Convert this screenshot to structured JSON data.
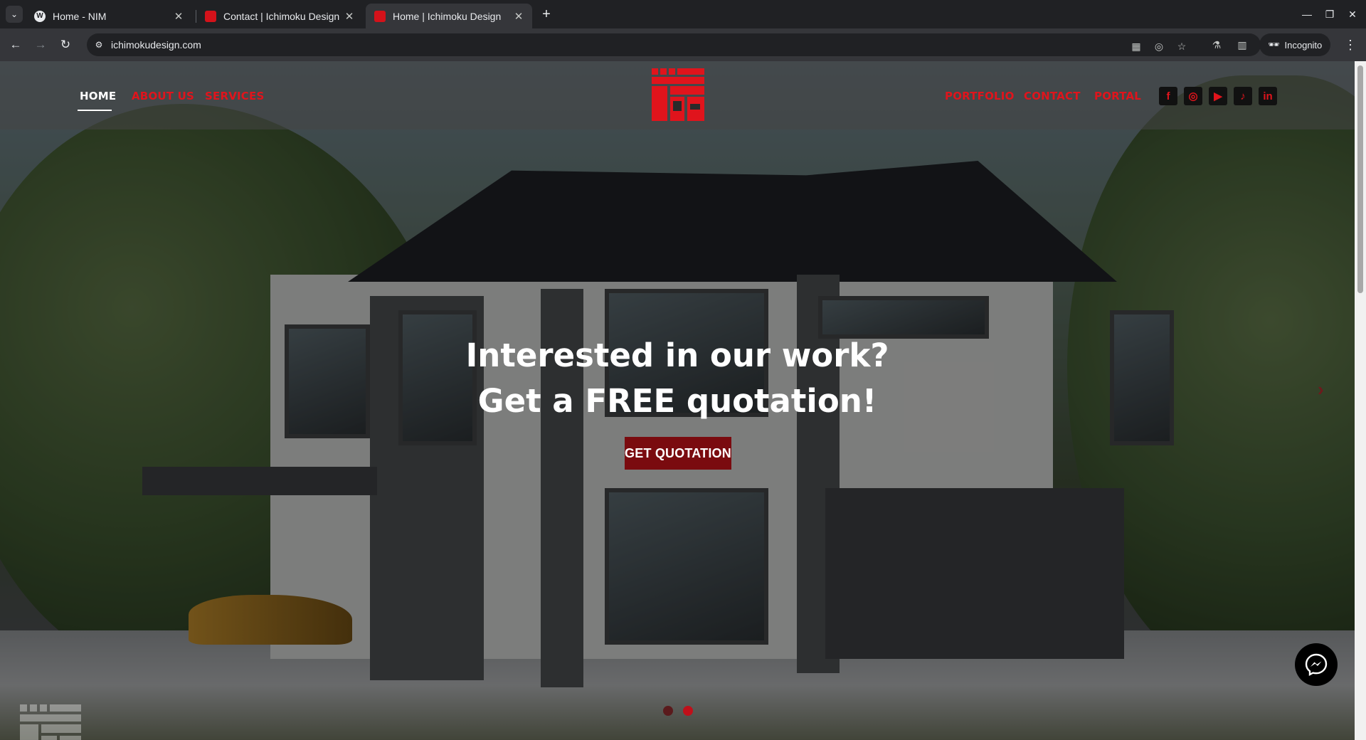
{
  "browser": {
    "tabs": [
      {
        "title": "Home - NIM",
        "active": false
      },
      {
        "title": "Contact | Ichimoku Design",
        "active": false
      },
      {
        "title": "Home | Ichimoku Design",
        "active": true
      }
    ],
    "url": "ichimokudesign.com",
    "profile_label": "Incognito"
  },
  "site": {
    "nav_left": [
      {
        "label": "HOME",
        "active": true
      },
      {
        "label": "ABOUT US",
        "active": false
      },
      {
        "label": "SERVICES",
        "active": false
      }
    ],
    "nav_right": [
      {
        "label": "PORTFOLIO"
      },
      {
        "label": "CONTACT"
      },
      {
        "label": "PORTAL"
      }
    ],
    "social_icons": [
      "facebook-icon",
      "instagram-icon",
      "youtube-icon",
      "tiktok-icon",
      "linkedin-icon"
    ],
    "brand_color": "#e0141c"
  },
  "hero": {
    "headline_line1": "Interested in our work?",
    "headline_line2": "Get a FREE quotation!",
    "cta_label": "GET QUOTATION",
    "cta_color": "#7a0b0f",
    "active_slide": 2,
    "slide_count": 2
  }
}
